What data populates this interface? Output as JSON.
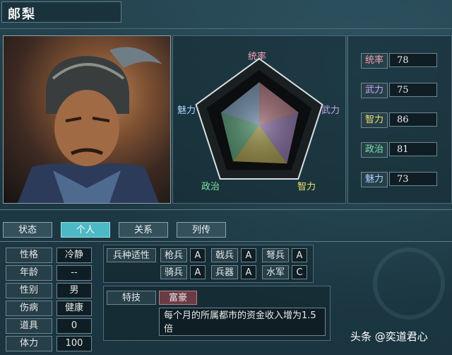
{
  "character": {
    "name": "郞梨"
  },
  "radar": {
    "labels": {
      "leadership": "统率",
      "war": "武力",
      "intelligence": "智力",
      "politics": "政治",
      "charisma": "魅力"
    },
    "values": {
      "leadership": 78,
      "war": 75,
      "intelligence": 86,
      "politics": 81,
      "charisma": 73
    },
    "colors": {
      "leadership": "#f6a3b4",
      "war": "#c9a2f0",
      "intelligence": "#f1e06a",
      "politics": "#7fe3a7",
      "charisma": "#a9d4ff"
    }
  },
  "stats": [
    {
      "label": "统率",
      "value": "78",
      "color": "#f6a3b4"
    },
    {
      "label": "武力",
      "value": "75",
      "color": "#c9a2f0"
    },
    {
      "label": "智力",
      "value": "86",
      "color": "#f1e06a"
    },
    {
      "label": "政治",
      "value": "81",
      "color": "#7fe3a7"
    },
    {
      "label": "魅力",
      "value": "73",
      "color": "#a9d4ff"
    }
  ],
  "tabs": [
    {
      "label": "状态"
    },
    {
      "label": "个人"
    },
    {
      "label": "关系"
    },
    {
      "label": "列传"
    }
  ],
  "personal": [
    {
      "label": "性格",
      "value": "冷静"
    },
    {
      "label": "年龄",
      "value": "--"
    },
    {
      "label": "性别",
      "value": "男"
    },
    {
      "label": "伤病",
      "value": "健康"
    },
    {
      "label": "道具",
      "value": "0"
    },
    {
      "label": "体力",
      "value": "100"
    }
  ],
  "aptitude": {
    "label": "兵种适性",
    "units": [
      {
        "name": "枪兵",
        "grade": "A"
      },
      {
        "name": "戟兵",
        "grade": "A"
      },
      {
        "name": "弩兵",
        "grade": "A"
      },
      {
        "name": "骑兵",
        "grade": "A"
      },
      {
        "name": "兵器",
        "grade": "A"
      },
      {
        "name": "水军",
        "grade": "C"
      }
    ]
  },
  "skill": {
    "label": "特技",
    "name": "富豪",
    "description": "每个月的所属都市的资金收入增为1.5倍"
  },
  "watermark": "头条 @奕道君心"
}
